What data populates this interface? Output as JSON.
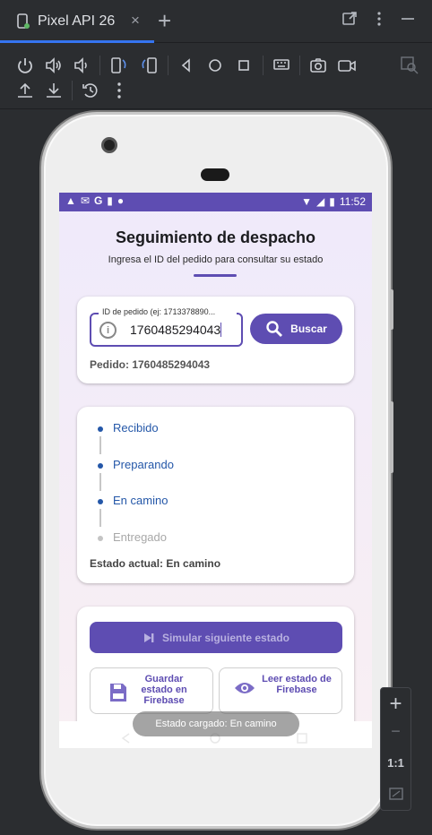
{
  "ide": {
    "tab_title": "Pixel API 26",
    "tab_close": "×",
    "tab_add": "+",
    "zoom_in": "+",
    "zoom_out": "−",
    "zoom_actual": "1:1"
  },
  "device": {
    "status_time": "11:52"
  },
  "app": {
    "title": "Seguimiento de despacho",
    "subtitle": "Ingresa el ID del pedido para consultar su estado",
    "search": {
      "field_label": "ID de pedido (ej: 1713378890...",
      "field_value": "1760485294043",
      "button_label": "Buscar",
      "order_line": "Pedido: 1760485294043"
    },
    "timeline": {
      "steps": [
        {
          "label": "Recibido",
          "done": true
        },
        {
          "label": "Preparando",
          "done": true
        },
        {
          "label": "En camino",
          "done": true
        },
        {
          "label": "Entregado",
          "done": false
        }
      ],
      "current_state": "Estado actual: En camino"
    },
    "actions": {
      "simulate_label": "Simular siguiente estado",
      "save_label": "Guardar estado en Firebase",
      "read_label": "Leer estado de Firebase"
    },
    "toast": "Estado cargado: En camino"
  },
  "colors": {
    "accent": "#5e4db2",
    "step_active": "#2457a8",
    "step_inactive": "#a8a8a8"
  }
}
